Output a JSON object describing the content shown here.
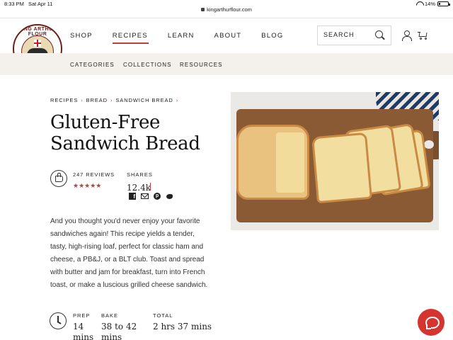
{
  "status_bar": {
    "time": "8:33 PM",
    "date": "Sat Apr 11",
    "url": "kingarthurflour.com",
    "battery": "14%",
    "battery_level": 0.14
  },
  "logo": {
    "text": "KING ARTHUR FLOUR"
  },
  "nav": {
    "items": [
      {
        "label": "SHOP"
      },
      {
        "label": "RECIPES",
        "active": true
      },
      {
        "label": "LEARN"
      },
      {
        "label": "ABOUT"
      },
      {
        "label": "BLOG"
      }
    ],
    "accent_color": "#c23c3c"
  },
  "search": {
    "label": "SEARCH"
  },
  "subnav": {
    "items": [
      {
        "label": "CATEGORIES"
      },
      {
        "label": "COLLECTIONS"
      },
      {
        "label": "RESOURCES"
      }
    ]
  },
  "breadcrumb": {
    "items": [
      "RECIPES",
      "BREAD",
      "SANDWICH BREAD"
    ],
    "separator": "›"
  },
  "recipe": {
    "title": "Gluten-Free Sandwich Bread",
    "reviews_label": "247 REVIEWS",
    "rating_stars": "★★★★★",
    "shares_label": "SHARES",
    "shares_count": "12.4k",
    "description": "And you thought you'd never enjoy your favorite sandwiches again! This recipe yields a tender, tasty, high-rising loaf, perfect for classic ham and cheese, a PB&J, or a BLT club. Toast and spread with butter and jam for breakfast, turn into French toast, or make a luscious grilled cheese sandwich.",
    "times": {
      "prep_label": "PREP",
      "prep_value": "14 mins",
      "bake_label": "BAKE",
      "bake_value": "38 to 42 mins",
      "total_label": "TOTAL",
      "total_value": "2 hrs 37 mins"
    }
  },
  "share_icons": [
    "facebook-icon",
    "mail-icon",
    "pinterest-icon",
    "twitter-icon"
  ],
  "chat_button_color": "#d5342f"
}
